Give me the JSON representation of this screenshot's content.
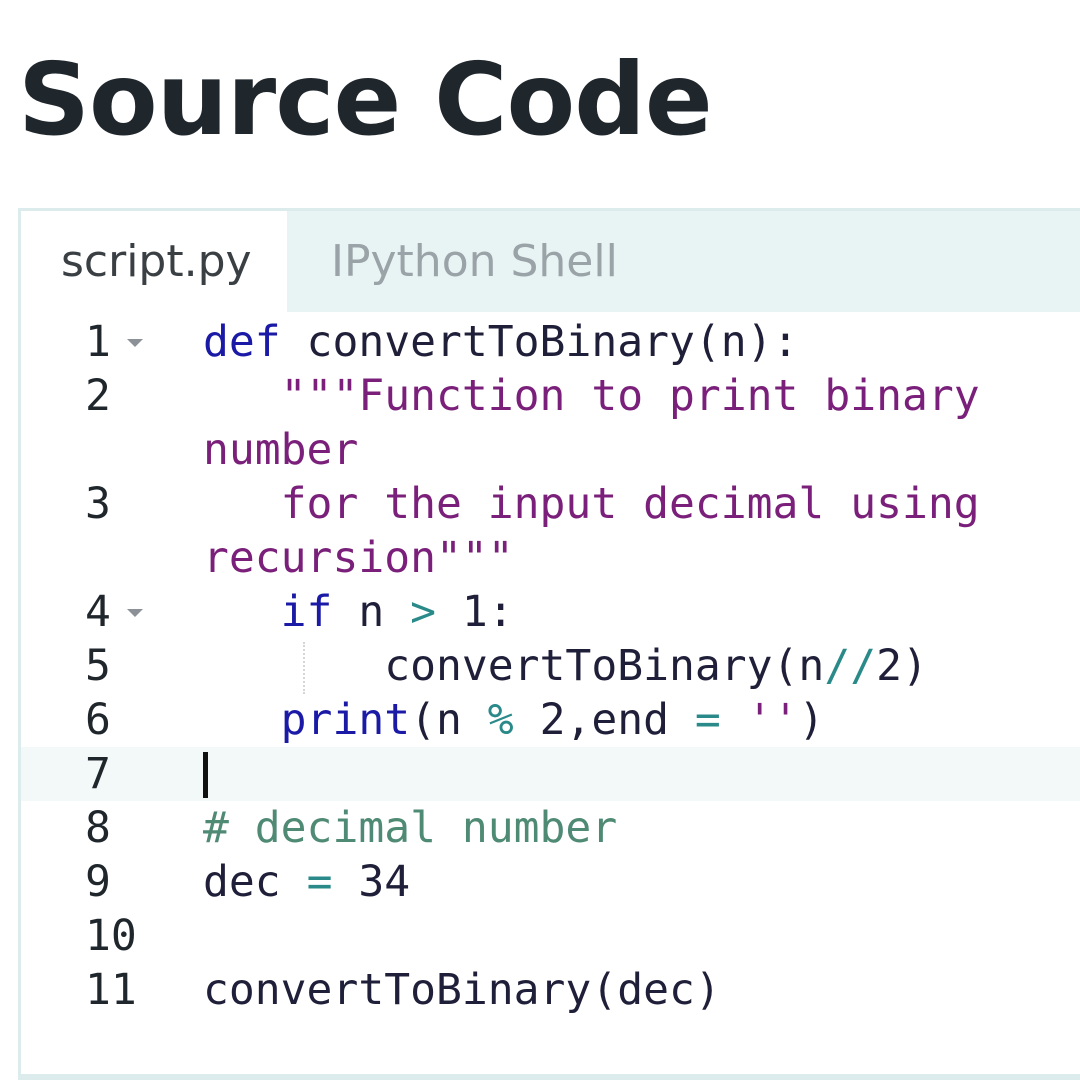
{
  "page": {
    "title": "Source Code"
  },
  "tabs": [
    {
      "label": "script.py",
      "active": true
    },
    {
      "label": "IPython Shell",
      "active": false
    }
  ],
  "editor": {
    "active_line": 7,
    "lines": [
      {
        "number": "1",
        "foldable": true,
        "wrap": false,
        "segments": [
          {
            "t": "def",
            "c": "kw"
          },
          {
            "t": " convertToBinary(n):",
            "c": ""
          }
        ]
      },
      {
        "number": "2",
        "foldable": false,
        "wrap": false,
        "segments": [
          {
            "t": "   \"\"\"Function to print binary",
            "c": "str"
          }
        ]
      },
      {
        "number": "",
        "foldable": false,
        "wrap": true,
        "segments": [
          {
            "t": "number",
            "c": "str"
          }
        ]
      },
      {
        "number": "3",
        "foldable": false,
        "wrap": false,
        "segments": [
          {
            "t": "   for the input decimal using",
            "c": "str"
          }
        ]
      },
      {
        "number": "",
        "foldable": false,
        "wrap": true,
        "segments": [
          {
            "t": "recursion\"\"\"",
            "c": "str"
          }
        ]
      },
      {
        "number": "4",
        "foldable": true,
        "wrap": false,
        "segments": [
          {
            "t": "   ",
            "c": ""
          },
          {
            "t": "if",
            "c": "kw"
          },
          {
            "t": " n ",
            "c": ""
          },
          {
            "t": ">",
            "c": "op"
          },
          {
            "t": " 1:",
            "c": ""
          }
        ]
      },
      {
        "number": "5",
        "foldable": false,
        "wrap": false,
        "segments": [
          {
            "t": "       convertToBinary(n",
            "c": ""
          },
          {
            "t": "//",
            "c": "op"
          },
          {
            "t": "2)",
            "c": ""
          }
        ]
      },
      {
        "number": "6",
        "foldable": false,
        "wrap": false,
        "segments": [
          {
            "t": "   ",
            "c": ""
          },
          {
            "t": "print",
            "c": "kw"
          },
          {
            "t": "(n ",
            "c": ""
          },
          {
            "t": "%",
            "c": "op"
          },
          {
            "t": " 2,end ",
            "c": ""
          },
          {
            "t": "=",
            "c": "op"
          },
          {
            "t": " ",
            "c": ""
          },
          {
            "t": "''",
            "c": "str"
          },
          {
            "t": ")",
            "c": ""
          }
        ]
      },
      {
        "number": "7",
        "foldable": false,
        "wrap": false,
        "segments": [
          {
            "t": "",
            "c": ""
          }
        ]
      },
      {
        "number": "8",
        "foldable": false,
        "wrap": false,
        "segments": [
          {
            "t": "# decimal number",
            "c": "cm"
          }
        ]
      },
      {
        "number": "9",
        "foldable": false,
        "wrap": false,
        "segments": [
          {
            "t": "dec ",
            "c": ""
          },
          {
            "t": "=",
            "c": "op"
          },
          {
            "t": " 34",
            "c": "num"
          }
        ]
      },
      {
        "number": "10",
        "foldable": false,
        "wrap": false,
        "segments": [
          {
            "t": "",
            "c": ""
          }
        ]
      },
      {
        "number": "11",
        "foldable": false,
        "wrap": false,
        "segments": [
          {
            "t": "convertToBinary(dec)",
            "c": ""
          }
        ]
      }
    ]
  },
  "colors": {
    "keyword": "#1a1aa6",
    "string": "#7a1f7a",
    "operator": "#2a8a8a",
    "comment": "#4f8a74",
    "tab_bar": "#e8f4f4",
    "active_line": "#f3f8f8"
  },
  "icons": {
    "fold": "chevron-down-icon"
  }
}
